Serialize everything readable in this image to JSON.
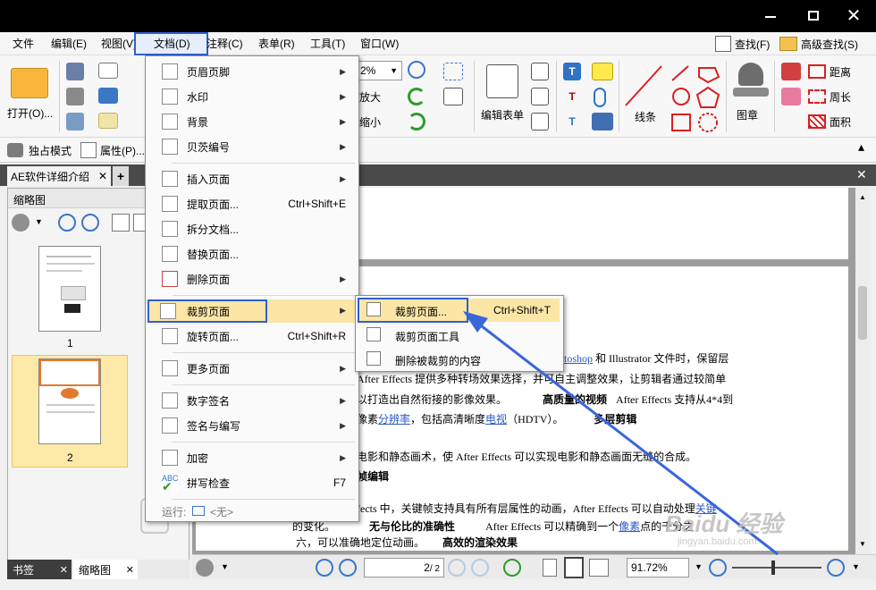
{
  "menubar": {
    "items": [
      "文件",
      "编辑(E)",
      "视图(V)",
      "文档(D)",
      "注释(C)",
      "表单(R)",
      "工具(T)",
      "窗口(W)"
    ],
    "find": "查找(F)",
    "advanced_find": "高级查找(S)"
  },
  "toolbar": {
    "open": "打开(O)...",
    "zoom_value": "2%",
    "zoom_in": "放大",
    "zoom_out": "缩小",
    "edit_form": "编辑表单",
    "line": "线条",
    "stamp": "图章",
    "distance": "距离",
    "perimeter": "周长",
    "area": "面积",
    "exclusive_mode": "独占模式",
    "properties": "属性(P)..."
  },
  "tab": {
    "title": "AE软件详细介绍",
    "add": "+"
  },
  "left_panel": {
    "title": "缩略图",
    "thumb1": "1",
    "thumb2": "2",
    "tab_bookmarks": "书签",
    "tab_thumbs": "缩略图"
  },
  "doc_menu": {
    "items": [
      {
        "label": "页眉页脚",
        "shortcut": ""
      },
      {
        "label": "水印",
        "shortcut": ""
      },
      {
        "label": "背景",
        "shortcut": ""
      },
      {
        "label": "贝茨编号",
        "shortcut": ""
      },
      {
        "label": "插入页面",
        "shortcut": ""
      },
      {
        "label": "提取页面...",
        "shortcut": "Ctrl+Shift+E"
      },
      {
        "label": "拆分文档...",
        "shortcut": ""
      },
      {
        "label": "替换页面...",
        "shortcut": ""
      },
      {
        "label": "删除页面",
        "shortcut": ""
      },
      {
        "label": "裁剪页面",
        "shortcut": ""
      },
      {
        "label": "旋转页面...",
        "shortcut": "Ctrl+Shift+R"
      },
      {
        "label": "更多页面",
        "shortcut": ""
      },
      {
        "label": "数字签名",
        "shortcut": ""
      },
      {
        "label": "签名与编写",
        "shortcut": ""
      },
      {
        "label": "加密",
        "shortcut": ""
      },
      {
        "label": "拼写检查",
        "shortcut": "F7"
      }
    ],
    "run_label": "运行:",
    "run_value": "<无>"
  },
  "crop_submenu": {
    "items": [
      {
        "label": "裁剪页面...",
        "shortcut": "Ctrl+Shift+T"
      },
      {
        "label": "裁剪页面工具",
        "shortcut": ""
      },
      {
        "label": "删除被裁剪的内容",
        "shortcut": ""
      }
    ]
  },
  "document": {
    "line1a": "toshop",
    "line1b": "和 Illustrator 文件时，保留层",
    "line2": "After Effects 提供多种转场效果选择，并可自主调整效果，让剪辑者通过较简单",
    "line3a": "以打造出自然衔接的影像效果。",
    "line3b": "高质量的视频",
    "line3c": "After Effects 支持从4*4到",
    "line4a": "像素",
    "line4b": "分辨率",
    "line4c": "，包括高清晰度",
    "line4d": "电视",
    "line4e": "（HDTV）。",
    "line4f": "多层剪辑",
    "line5": "电影和静态画术，使 After Effects 可以实现电影和静态画面无缝的合成。",
    "line6": "帧编辑",
    "line7a": "fects 中，关键帧支持具有所有层属性的动画，After Effects 可以自动处理",
    "line7b": "关键",
    "line8a": "的变化。",
    "line8b": "无与伦比的准确性",
    "line8c": "After Effects 可以精确到一个",
    "line8d": "像素",
    "line8e": "点的千分之",
    "line9a": "六，可以准确地定位动画。",
    "line9b": "高效的渲染效果"
  },
  "status": {
    "page_value": "2",
    "page_total": "/ 2",
    "zoom_value": "91.72%"
  },
  "watermark": "Baidu 经验",
  "watermark_url": "jingyan.baidu.com",
  "colors": {
    "highlight_border": "#2f5fd0",
    "menu_hover": "#fbe6a6",
    "link": "#2a58c7"
  }
}
